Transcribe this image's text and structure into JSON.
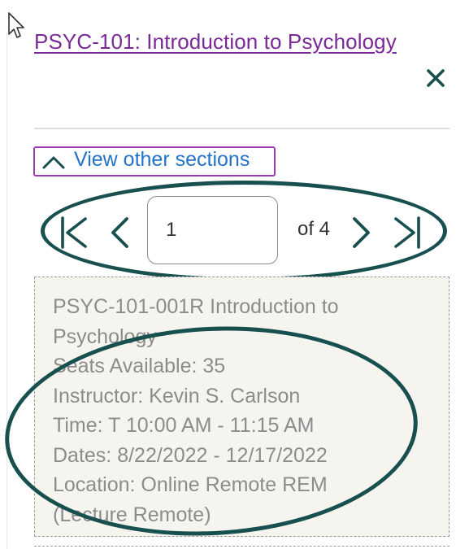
{
  "course": {
    "title": "PSYC-101: Introduction to Psychology"
  },
  "actions": {
    "close_icon": "close-icon",
    "view_other_sections": "View other sections"
  },
  "pager": {
    "current_page": "1",
    "total_label": "of 4",
    "icons": [
      "first-page-icon",
      "prev-page-icon",
      "next-page-icon",
      "last-page-icon"
    ]
  },
  "section": {
    "title_line1": "PSYC-101-001R Introduction to",
    "title_line2": "Psychology",
    "seats": "Seats Available: 35",
    "instructor": "Instructor: Kevin S. Carlson",
    "time": "Time: T 10:00 AM - 11:15 AM",
    "dates": "Dates: 8/22/2022 - 12/17/2022",
    "location_line1": "Location: Online Remote REM",
    "location_line2": "(Lecture Remote)"
  },
  "colors": {
    "link_purple": "#7a2a96",
    "focus_border": "#9b3bb5",
    "action_blue": "#2273c9",
    "icon_teal": "#184f4f",
    "card_background": "#f6f4ef",
    "muted_text": "#8c8c8c"
  }
}
